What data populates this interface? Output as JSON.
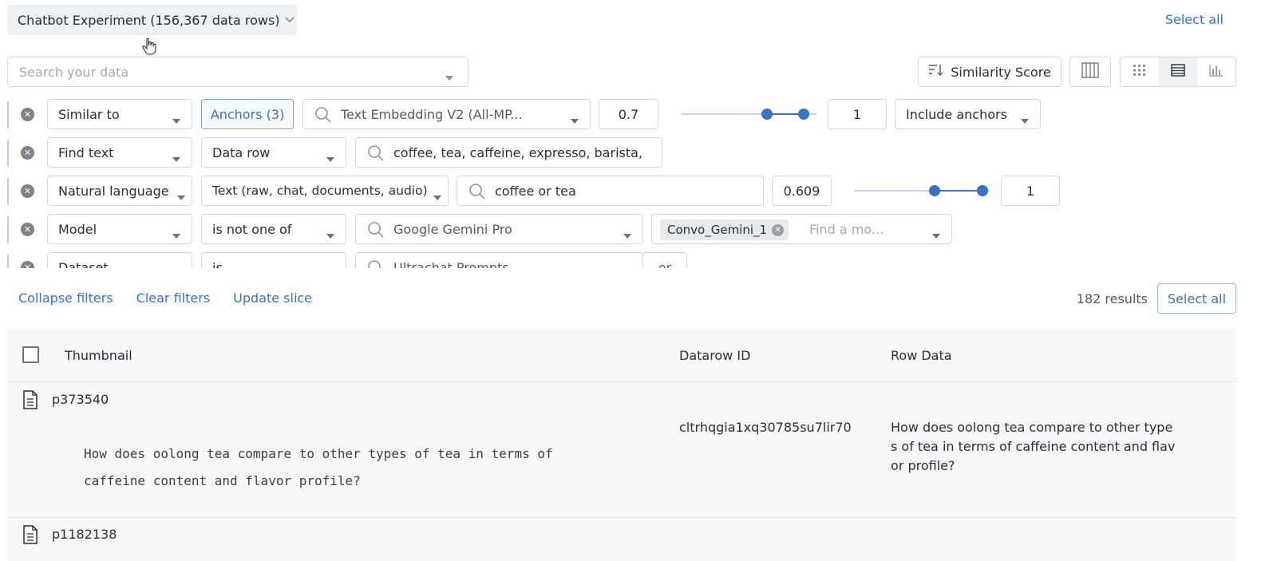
{
  "header": {
    "dataset_label": "Chatbot Experiment (156,367 data rows)",
    "select_all": "Select all"
  },
  "search": {
    "placeholder": "Search your data"
  },
  "toolbar": {
    "sort_label": "Similarity Score"
  },
  "filters": [
    {
      "field": "Similar to",
      "anchors": "Anchors (3)",
      "embedding": "Text Embedding V2 (All-MP...",
      "min": "0.7",
      "max": "1",
      "range": [
        0.7,
        1
      ],
      "option": "Include anchors"
    },
    {
      "field": "Find text",
      "scope": "Data row",
      "query": "coffee, tea, caffeine, expresso, barista,"
    },
    {
      "field": "Natural language",
      "scope": "Text (raw, chat, documents, audio)",
      "query": "coffee or tea",
      "min": "0.609",
      "max": "1",
      "range": [
        0.609,
        1
      ]
    },
    {
      "field": "Model",
      "operator": "is not one of",
      "value": "Google Gemini Pro",
      "chip": "Convo_Gemini_1",
      "placeholder": "Find a mo..."
    },
    {
      "field": "Dataset",
      "operator": "is",
      "value": "Ultrachat Prompts",
      "extra": "or"
    }
  ],
  "actions": {
    "collapse": "Collapse filters",
    "clear": "Clear filters",
    "update": "Update slice",
    "results": "182 results",
    "select_all": "Select all"
  },
  "table": {
    "columns": [
      "Thumbnail",
      "Datarow ID",
      "Row Data"
    ],
    "rows": [
      {
        "id": "p373540",
        "thumbnail_text": "How does oolong tea compare to other types of tea in terms of caffeine content and flavor profile?",
        "datarow_id": "cltrhqgia1xq30785su7lir70",
        "row_data": "How does oolong tea compare to other types of tea in terms of caffeine content and flavor profile?"
      },
      {
        "id": "p1182138"
      }
    ]
  },
  "icons": {
    "caret": "caret-down-icon",
    "search": "search-icon",
    "remove": "remove-filter-icon",
    "document": "document-icon",
    "sort": "sort-icon",
    "columns": "columns-icon",
    "grid": "grid-view-icon",
    "list": "list-view-icon",
    "chart": "chart-view-icon"
  },
  "colors": {
    "accent": "#3b73c2",
    "border": "#d6dae0",
    "table_bg": "#f7f8f9"
  }
}
